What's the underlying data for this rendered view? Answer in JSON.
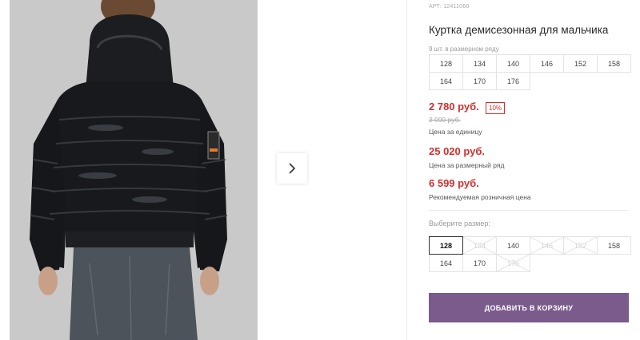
{
  "product": {
    "article": "АРТ: 12411060",
    "title": "Куртка демисезонная для мальчика",
    "range_note": "9 шт. в размерном ряду",
    "size_range": [
      "128",
      "134",
      "140",
      "146",
      "152",
      "158",
      "164",
      "170",
      "176"
    ]
  },
  "prices": {
    "unit_price": "2 780 руб.",
    "discount": "10%",
    "old_price": "3 090 руб.",
    "unit_label": "Цена за единицу",
    "range_price": "25 020 руб.",
    "range_label": "Цена за размерный ряд",
    "retail_price": "6 599 руб.",
    "retail_label": "Рекомендуемая розничная цена"
  },
  "size_select": {
    "label": "Выберите размер:",
    "sizes": [
      {
        "value": "128",
        "state": "selected"
      },
      {
        "value": "134",
        "state": "disabled"
      },
      {
        "value": "140",
        "state": "available"
      },
      {
        "value": "146",
        "state": "disabled"
      },
      {
        "value": "152",
        "state": "disabled"
      },
      {
        "value": "158",
        "state": "available"
      },
      {
        "value": "164",
        "state": "available"
      },
      {
        "value": "170",
        "state": "available"
      },
      {
        "value": "176",
        "state": "disabled"
      }
    ]
  },
  "actions": {
    "add_to_cart": "Добавить в корзину"
  },
  "colors": {
    "accent": "#7b5b8c",
    "price": "#d32f2f"
  },
  "icons": {
    "next": "chevron-right-icon",
    "disabled_cross": "cross-out-icon"
  }
}
